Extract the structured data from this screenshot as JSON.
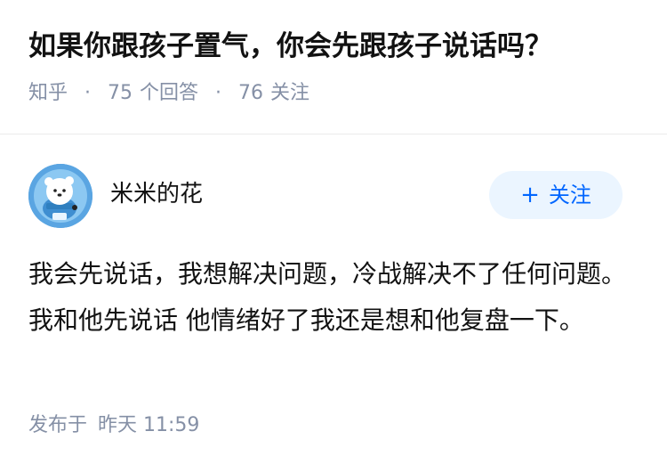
{
  "question": {
    "title": "如果你跟孩子置气，你会先跟孩子说话吗？",
    "source": "知乎",
    "separator": "·",
    "answer_count": "75",
    "answer_label": "个回答",
    "follower_count": "76",
    "follower_label": "关注"
  },
  "author": {
    "name": "米米的花",
    "avatar_icon": "cartoon-bear-avatar-icon",
    "follow_button": {
      "icon": "+",
      "label": "关注"
    }
  },
  "answer": {
    "content": "我会先说话，我想解决问题，冷战解决不了任何问题。我和他先说话 他情绪好了我还是想和他复盘一下。",
    "time_label": "发布于",
    "time_value": "昨天 11:59"
  },
  "colors": {
    "title": "#121212",
    "meta": "#8590a6",
    "accent": "#0066ff",
    "follow_button_bg": "#ebf5ff",
    "divider": "#ebebeb",
    "avatar_bg": "#5aa5e2"
  }
}
